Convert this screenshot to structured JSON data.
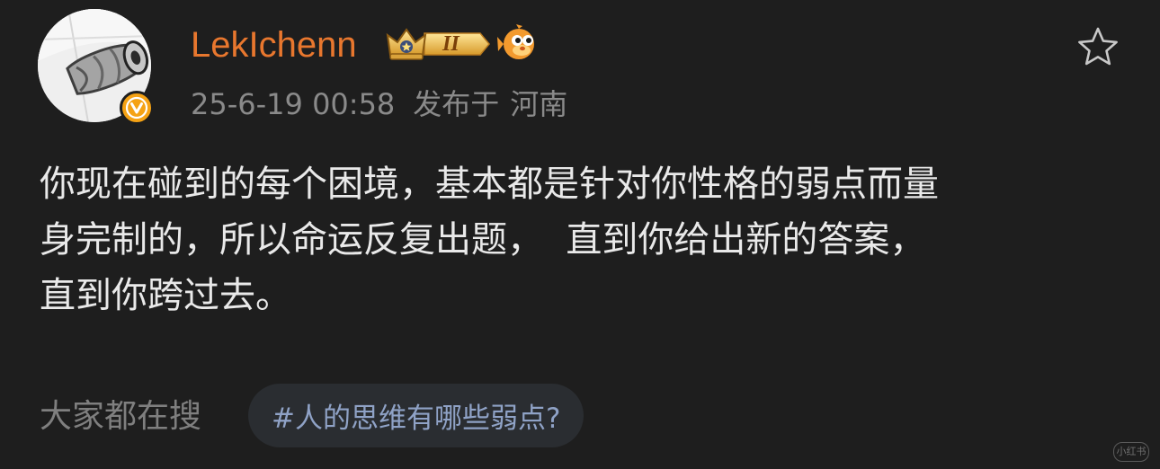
{
  "post": {
    "username": "LekIchenn",
    "level_badge": "II",
    "date": "25-6-19 00:58",
    "location_prefix": "发布于",
    "location": "河南",
    "text": "你现在碰到的每个困境，基本都是针对你性格的弱点而量\n身完制的，所以命运反复出题，  直到你给出新的答案，\n直到你跨过去。"
  },
  "search": {
    "label": "大家都在搜",
    "topic": "#人的思维有哪些弱点?"
  },
  "watermark": {
    "text": "小红书"
  },
  "colors": {
    "background": "#1e1e1e",
    "username": "#e8772e",
    "meta": "#8a8a8a",
    "body_text": "#e9e9e9",
    "topic_text": "#8fa2c6",
    "topic_bg": "#2a2d31",
    "verified_badge": "#f5a214"
  },
  "icons": {
    "avatar": "crushed-can-avatar",
    "verified": "verified-v-icon",
    "crown": "crown-level-icon",
    "emoji": "pufferfish-emoji-icon",
    "favorite": "star-outline-icon"
  }
}
